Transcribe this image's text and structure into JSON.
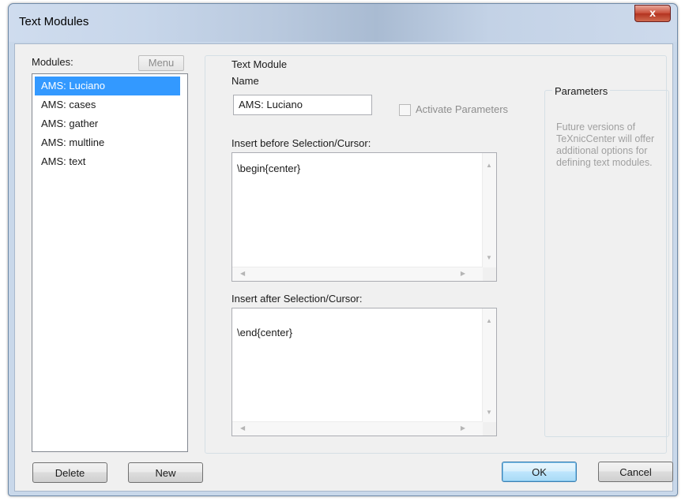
{
  "window": {
    "title": "Text Modules",
    "close_glyph": "x"
  },
  "modules": {
    "label": "Modules:",
    "menu_label": "Menu",
    "items": [
      "AMS: Luciano",
      "AMS: cases",
      "AMS: gather",
      "AMS: multline",
      "AMS: text"
    ],
    "selected_index": 0
  },
  "text_module": {
    "group_label": "Text Module",
    "name_label": "Name",
    "name_value": "AMS: Luciano",
    "activate_label": "Activate Parameters",
    "activate_checked": false,
    "before_label": "Insert before Selection/Cursor:",
    "before_text": "\\begin{center}",
    "after_label": "Insert after Selection/Cursor:",
    "after_text": "\\end{center}"
  },
  "parameters": {
    "title": "Parameters",
    "message": "Future versions of TeXnicCenter will offer additional options for defining text modules."
  },
  "buttons": {
    "delete": "Delete",
    "new": "New",
    "ok": "OK",
    "cancel": "Cancel"
  },
  "colors": {
    "selection": "#3399ff",
    "dialog_bg": "#f0f0f0",
    "frame": "#c9d8ea",
    "close": "#c9503b"
  }
}
